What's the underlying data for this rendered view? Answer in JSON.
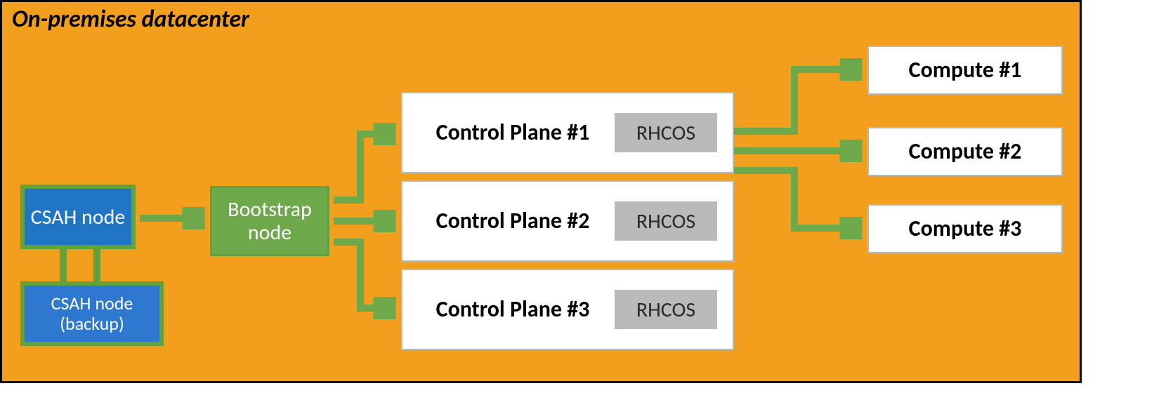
{
  "title": "On-premises datacenter",
  "csah": {
    "label": "CSAH node"
  },
  "csah_backup": {
    "label": "CSAH node (backup)"
  },
  "bootstrap": {
    "label": "Bootstrap node"
  },
  "control_planes": [
    {
      "label": "Control Plane #1",
      "os": "RHCOS"
    },
    {
      "label": "Control Plane #2",
      "os": "RHCOS"
    },
    {
      "label": "Control Plane #3",
      "os": "RHCOS"
    }
  ],
  "computes": [
    {
      "label": "Compute #1"
    },
    {
      "label": "Compute #2"
    },
    {
      "label": "Compute #3"
    }
  ]
}
